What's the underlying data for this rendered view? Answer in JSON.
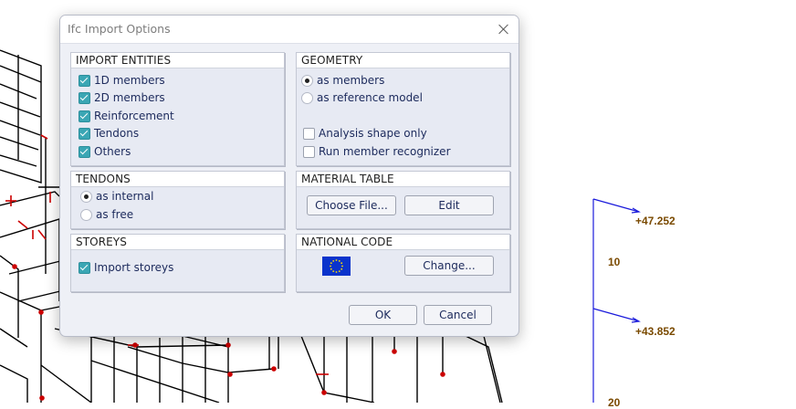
{
  "background_labels": {
    "level_1": "+47.252",
    "level_2": "10",
    "level_3": "+43.852",
    "level_4": "20"
  },
  "dialog": {
    "title": "Ifc Import Options",
    "close_icon": "close-icon",
    "import_entities": {
      "title": "IMPORT ENTITIES",
      "items": [
        {
          "label": "1D members",
          "checked": true
        },
        {
          "label": "2D members",
          "checked": true
        },
        {
          "label": "Reinforcement",
          "checked": true
        },
        {
          "label": "Tendons",
          "checked": true
        },
        {
          "label": "Others",
          "checked": true
        }
      ]
    },
    "geometry": {
      "title": "GEOMETRY",
      "radio": [
        {
          "label": "as members",
          "selected": true
        },
        {
          "label": "as reference model",
          "selected": false
        }
      ],
      "checks": [
        {
          "label": "Analysis shape only",
          "checked": false
        },
        {
          "label": "Run member recognizer",
          "checked": false
        }
      ]
    },
    "tendons": {
      "title": "TENDONS",
      "radio": [
        {
          "label": "as internal",
          "selected": true
        },
        {
          "label": "as free",
          "selected": false
        }
      ]
    },
    "material_table": {
      "title": "MATERIAL TABLE",
      "choose_file_label": "Choose File...",
      "edit_label": "Edit"
    },
    "storeys": {
      "title": "STOREYS",
      "import_storeys": {
        "label": "Import storeys",
        "checked": true
      }
    },
    "national_code": {
      "title": "NATIONAL CODE",
      "flag_icon": "eu-flag-icon",
      "change_label": "Change..."
    },
    "ok_label": "OK",
    "cancel_label": "Cancel"
  },
  "colors": {
    "accent_check": "#3aa6b4",
    "label_text": "#1c2a5c",
    "level_text": "#7a4a00",
    "level_line": "#1a1adb",
    "model_marks": "#cc0000"
  }
}
